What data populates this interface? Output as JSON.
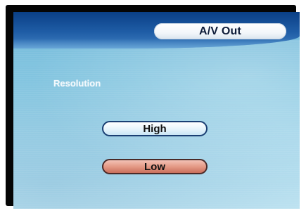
{
  "window": {
    "title": "A/V Out"
  },
  "settings": {
    "resolution_label": "Resolution"
  },
  "options": [
    {
      "label": "High",
      "selected": false
    },
    {
      "label": "Low",
      "selected": true
    }
  ],
  "colors": {
    "header_blue": "#1f5da6",
    "background_blue": "#86c7e1",
    "highlight_red": "#e49a86",
    "option_white": "#e9f5fc"
  }
}
